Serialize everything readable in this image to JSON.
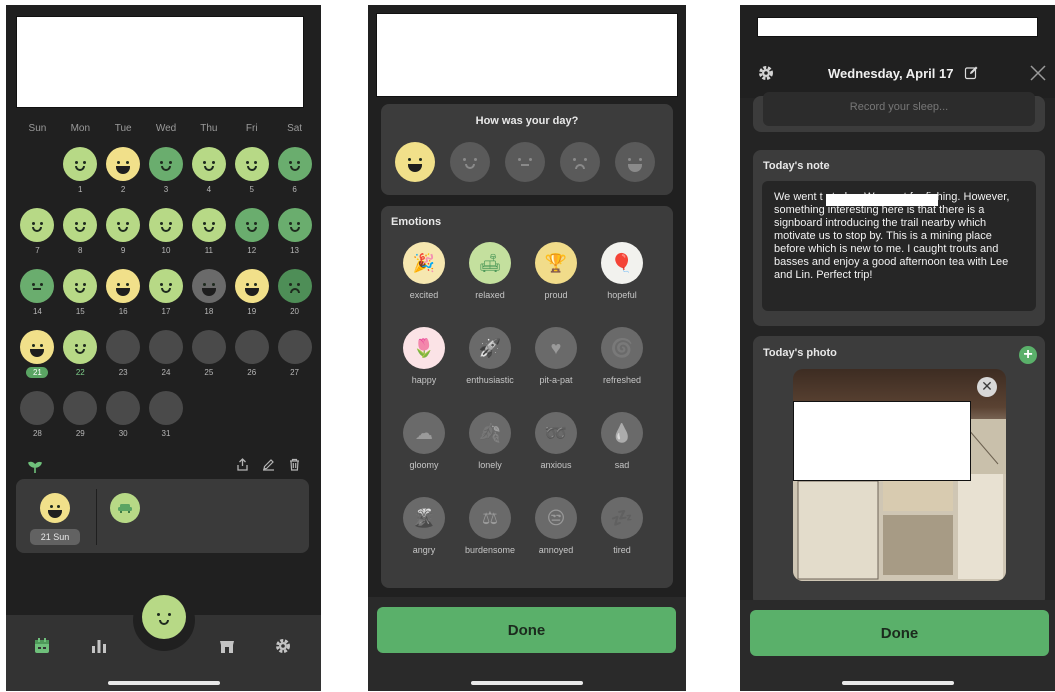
{
  "colors": {
    "background": "#202020",
    "card": "#3c3c3c",
    "accent_green": "#5ab06a",
    "mood_yellow": "#f1e08a",
    "mood_lightgreen": "#b7d986",
    "mood_green": "#6aad6e",
    "mood_darkgreen": "#4e8e57",
    "mood_gray": "#6a6a6a",
    "empty_day": "#4a4a4a"
  },
  "calendar": {
    "weekdays": [
      "Sun",
      "Mon",
      "Tue",
      "Wed",
      "Thu",
      "Fri",
      "Sat"
    ],
    "days": [
      {
        "label": "1",
        "mood": "good"
      },
      {
        "label": "2",
        "mood": "great"
      },
      {
        "label": "3",
        "mood": "good-dark"
      },
      {
        "label": "4",
        "mood": "good"
      },
      {
        "label": "5",
        "mood": "good"
      },
      {
        "label": "6",
        "mood": "good-dark"
      },
      {
        "label": "7",
        "mood": "good"
      },
      {
        "label": "8",
        "mood": "good"
      },
      {
        "label": "9",
        "mood": "good"
      },
      {
        "label": "10",
        "mood": "good"
      },
      {
        "label": "11",
        "mood": "good"
      },
      {
        "label": "12",
        "mood": "good-dark"
      },
      {
        "label": "13",
        "mood": "good-dark"
      },
      {
        "label": "14",
        "mood": "okay"
      },
      {
        "label": "15",
        "mood": "good"
      },
      {
        "label": "16",
        "mood": "great"
      },
      {
        "label": "17",
        "mood": "good"
      },
      {
        "label": "18",
        "mood": "awful"
      },
      {
        "label": "19",
        "mood": "great"
      },
      {
        "label": "20",
        "mood": "bad"
      },
      {
        "label": "21",
        "mood": "great"
      },
      {
        "label": "22",
        "mood": "good"
      },
      {
        "label": "23",
        "mood": "empty"
      },
      {
        "label": "24",
        "mood": "empty"
      },
      {
        "label": "25",
        "mood": "empty"
      },
      {
        "label": "26",
        "mood": "empty"
      },
      {
        "label": "27",
        "mood": "empty"
      },
      {
        "label": "28",
        "mood": "empty"
      },
      {
        "label": "29",
        "mood": "empty"
      },
      {
        "label": "30",
        "mood": "empty"
      },
      {
        "label": "31",
        "mood": "empty"
      }
    ],
    "first_weekday_index": 1,
    "today": "21",
    "highlight_day": "22"
  },
  "entry": {
    "date_label": "21 Sun",
    "mood": "great",
    "emotion_icon": "sofa-icon"
  },
  "tabbar": {
    "items": [
      "calendar-icon",
      "stats-icon",
      "add-mood-button",
      "store-icon",
      "settings-icon"
    ]
  },
  "mood_picker": {
    "question": "How was your day?",
    "options": [
      "great",
      "good",
      "okay",
      "bad",
      "awful"
    ],
    "selected": "great"
  },
  "emotions": {
    "title": "Emotions",
    "items": [
      {
        "label": "excited",
        "icon": "party-popper-icon",
        "selected": true
      },
      {
        "label": "relaxed",
        "icon": "sofa-icon",
        "selected": true
      },
      {
        "label": "proud",
        "icon": "trophy-icon",
        "selected": true
      },
      {
        "label": "hopeful",
        "icon": "balloon-icon",
        "selected": true
      },
      {
        "label": "happy",
        "icon": "flowers-icon",
        "selected": true
      },
      {
        "label": "enthusiastic",
        "icon": "rocket-icon",
        "selected": false
      },
      {
        "label": "pit-a-pat",
        "icon": "heart-icon",
        "selected": false
      },
      {
        "label": "refreshed",
        "icon": "wind-icon",
        "selected": false
      },
      {
        "label": "gloomy",
        "icon": "cloud-icon",
        "selected": false
      },
      {
        "label": "lonely",
        "icon": "leaf-icon",
        "selected": false
      },
      {
        "label": "anxious",
        "icon": "rope-icon",
        "selected": false
      },
      {
        "label": "sad",
        "icon": "tear-icon",
        "selected": false
      },
      {
        "label": "angry",
        "icon": "volcano-icon",
        "selected": false
      },
      {
        "label": "burdensome",
        "icon": "weight-icon",
        "selected": false
      },
      {
        "label": "annoyed",
        "icon": "annoyed-face-icon",
        "selected": false
      },
      {
        "label": "tired",
        "icon": "zzz-icon",
        "selected": false
      }
    ]
  },
  "done_label": "Done",
  "detail": {
    "date_title": "Wednesday, April 17",
    "sleep_placeholder": "Record your sleep...",
    "note_title": "Today's note",
    "note_text": "We went t                  ; today. We went for fishing. However, something interesting here is that there is a signboard introducing the trail nearby which motivate us to stop by. This is a mining place before which is new to me. I caught trouts and basses and enjoy a good afternoon tea with Lee and Lin. Perfect trip!",
    "photo_title": "Today's photo"
  }
}
